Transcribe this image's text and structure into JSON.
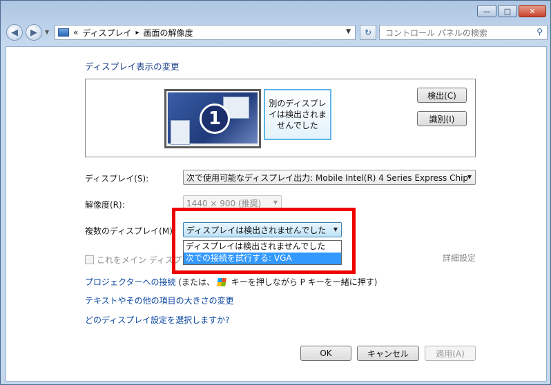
{
  "window": {
    "buttons": {
      "minimize": "—",
      "maximize": "□",
      "close": "✕"
    }
  },
  "addressbar": {
    "back": "◀",
    "forward": "▶",
    "prefix": "«",
    "crumb1": "ディスプレイ",
    "separator": "▸",
    "crumb2": "画面の解像度",
    "dropdown": "▼",
    "refresh": "↻",
    "search_placeholder": "コントロール パネルの検索",
    "search_icon": "⚲"
  },
  "main": {
    "heading": "ディスプレイ表示の変更",
    "monitor1_number": "1",
    "monitor2_text": "別のディスプレイは検出されませんでした",
    "detect_button": "検出(C)",
    "identify_button": "識別(I)",
    "display_label": "ディスプレイ(S):",
    "display_value": "次で使用可能なディスプレイ出力: Mobile Intel(R) 4 Series Express Chip",
    "resolution_label": "解像度(R):",
    "resolution_value": "1440 × 900 (推奨)",
    "multi_label": "複数のディスプレイ(M):",
    "multi_value": "ディスプレイは検出されませんでした",
    "multi_options": [
      "ディスプレイは検出されませんでした",
      "次での接続を試行する: VGA"
    ],
    "main_display_checkbox": "これをメイン ディスプレイにする",
    "advanced": "詳細設定",
    "projector_link": "プロジェクターへの接続",
    "projector_text_before": " (または、",
    "projector_text_after": " キーを押しながら P キーを一緒に押す)",
    "text_size_link": "テキストやその他の項目の大きさの変更",
    "which_setting_link": "どのディスプレイ設定を選択しますか?"
  },
  "footer": {
    "ok": "OK",
    "cancel": "キャンセル",
    "apply": "適用(A)"
  },
  "colors": {
    "highlight": "#ee0000",
    "link": "#0a46a0",
    "selection": "#3399ff"
  }
}
